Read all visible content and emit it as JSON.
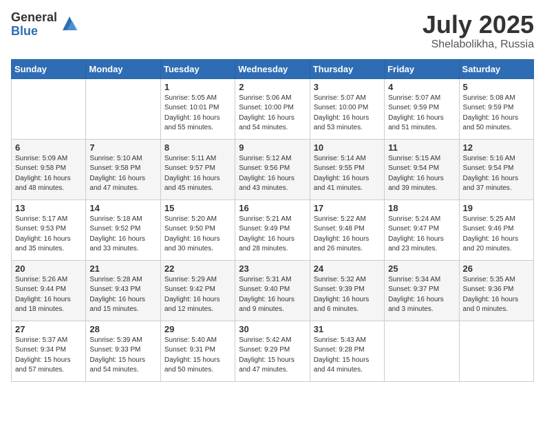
{
  "header": {
    "logo_general": "General",
    "logo_blue": "Blue",
    "month_year": "July 2025",
    "location": "Shelabolikha, Russia"
  },
  "days_of_week": [
    "Sunday",
    "Monday",
    "Tuesday",
    "Wednesday",
    "Thursday",
    "Friday",
    "Saturday"
  ],
  "weeks": [
    [
      {
        "day": "",
        "info": ""
      },
      {
        "day": "",
        "info": ""
      },
      {
        "day": "1",
        "info": "Sunrise: 5:05 AM\nSunset: 10:01 PM\nDaylight: 16 hours and 55 minutes."
      },
      {
        "day": "2",
        "info": "Sunrise: 5:06 AM\nSunset: 10:00 PM\nDaylight: 16 hours and 54 minutes."
      },
      {
        "day": "3",
        "info": "Sunrise: 5:07 AM\nSunset: 10:00 PM\nDaylight: 16 hours and 53 minutes."
      },
      {
        "day": "4",
        "info": "Sunrise: 5:07 AM\nSunset: 9:59 PM\nDaylight: 16 hours and 51 minutes."
      },
      {
        "day": "5",
        "info": "Sunrise: 5:08 AM\nSunset: 9:59 PM\nDaylight: 16 hours and 50 minutes."
      }
    ],
    [
      {
        "day": "6",
        "info": "Sunrise: 5:09 AM\nSunset: 9:58 PM\nDaylight: 16 hours and 48 minutes."
      },
      {
        "day": "7",
        "info": "Sunrise: 5:10 AM\nSunset: 9:58 PM\nDaylight: 16 hours and 47 minutes."
      },
      {
        "day": "8",
        "info": "Sunrise: 5:11 AM\nSunset: 9:57 PM\nDaylight: 16 hours and 45 minutes."
      },
      {
        "day": "9",
        "info": "Sunrise: 5:12 AM\nSunset: 9:56 PM\nDaylight: 16 hours and 43 minutes."
      },
      {
        "day": "10",
        "info": "Sunrise: 5:14 AM\nSunset: 9:55 PM\nDaylight: 16 hours and 41 minutes."
      },
      {
        "day": "11",
        "info": "Sunrise: 5:15 AM\nSunset: 9:54 PM\nDaylight: 16 hours and 39 minutes."
      },
      {
        "day": "12",
        "info": "Sunrise: 5:16 AM\nSunset: 9:54 PM\nDaylight: 16 hours and 37 minutes."
      }
    ],
    [
      {
        "day": "13",
        "info": "Sunrise: 5:17 AM\nSunset: 9:53 PM\nDaylight: 16 hours and 35 minutes."
      },
      {
        "day": "14",
        "info": "Sunrise: 5:18 AM\nSunset: 9:52 PM\nDaylight: 16 hours and 33 minutes."
      },
      {
        "day": "15",
        "info": "Sunrise: 5:20 AM\nSunset: 9:50 PM\nDaylight: 16 hours and 30 minutes."
      },
      {
        "day": "16",
        "info": "Sunrise: 5:21 AM\nSunset: 9:49 PM\nDaylight: 16 hours and 28 minutes."
      },
      {
        "day": "17",
        "info": "Sunrise: 5:22 AM\nSunset: 9:48 PM\nDaylight: 16 hours and 26 minutes."
      },
      {
        "day": "18",
        "info": "Sunrise: 5:24 AM\nSunset: 9:47 PM\nDaylight: 16 hours and 23 minutes."
      },
      {
        "day": "19",
        "info": "Sunrise: 5:25 AM\nSunset: 9:46 PM\nDaylight: 16 hours and 20 minutes."
      }
    ],
    [
      {
        "day": "20",
        "info": "Sunrise: 5:26 AM\nSunset: 9:44 PM\nDaylight: 16 hours and 18 minutes."
      },
      {
        "day": "21",
        "info": "Sunrise: 5:28 AM\nSunset: 9:43 PM\nDaylight: 16 hours and 15 minutes."
      },
      {
        "day": "22",
        "info": "Sunrise: 5:29 AM\nSunset: 9:42 PM\nDaylight: 16 hours and 12 minutes."
      },
      {
        "day": "23",
        "info": "Sunrise: 5:31 AM\nSunset: 9:40 PM\nDaylight: 16 hours and 9 minutes."
      },
      {
        "day": "24",
        "info": "Sunrise: 5:32 AM\nSunset: 9:39 PM\nDaylight: 16 hours and 6 minutes."
      },
      {
        "day": "25",
        "info": "Sunrise: 5:34 AM\nSunset: 9:37 PM\nDaylight: 16 hours and 3 minutes."
      },
      {
        "day": "26",
        "info": "Sunrise: 5:35 AM\nSunset: 9:36 PM\nDaylight: 16 hours and 0 minutes."
      }
    ],
    [
      {
        "day": "27",
        "info": "Sunrise: 5:37 AM\nSunset: 9:34 PM\nDaylight: 15 hours and 57 minutes."
      },
      {
        "day": "28",
        "info": "Sunrise: 5:39 AM\nSunset: 9:33 PM\nDaylight: 15 hours and 54 minutes."
      },
      {
        "day": "29",
        "info": "Sunrise: 5:40 AM\nSunset: 9:31 PM\nDaylight: 15 hours and 50 minutes."
      },
      {
        "day": "30",
        "info": "Sunrise: 5:42 AM\nSunset: 9:29 PM\nDaylight: 15 hours and 47 minutes."
      },
      {
        "day": "31",
        "info": "Sunrise: 5:43 AM\nSunset: 9:28 PM\nDaylight: 15 hours and 44 minutes."
      },
      {
        "day": "",
        "info": ""
      },
      {
        "day": "",
        "info": ""
      }
    ]
  ]
}
